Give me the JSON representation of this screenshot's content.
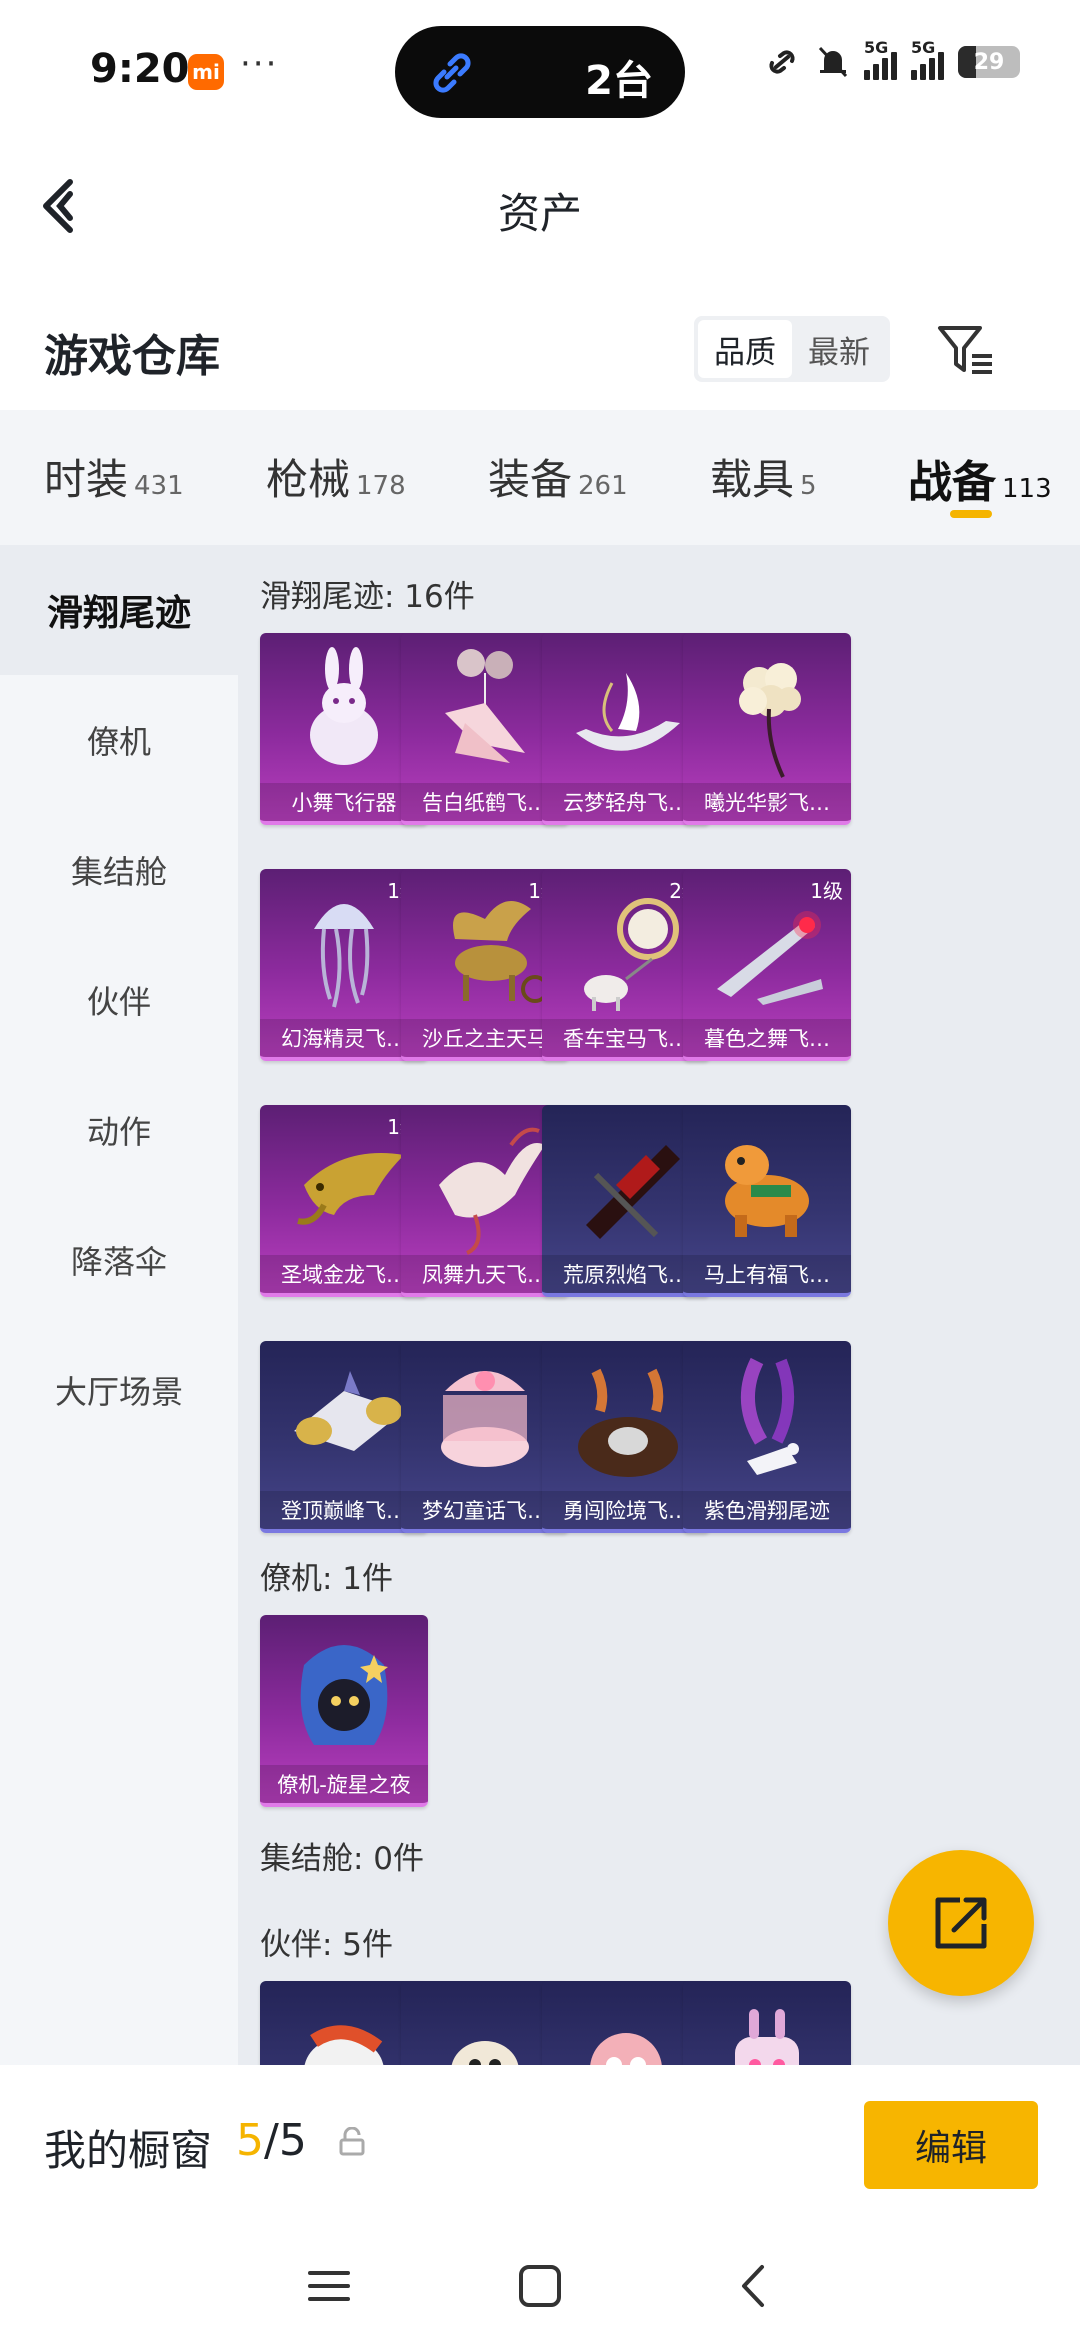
{
  "status_bar": {
    "time": "9:20",
    "mi_badge": "mi",
    "dots": "···",
    "island_text": "2台",
    "battery": "29",
    "battery_level": 0.29,
    "signal_labels": [
      "5G",
      "5G"
    ]
  },
  "header": {
    "title": "资产",
    "back_icon": "chevron-left-icon"
  },
  "warehouse": {
    "title": "游戏仓库",
    "sort_options": [
      "品质",
      "最新"
    ],
    "sort_selected": "品质",
    "filter_icon": "filter-icon"
  },
  "tabs": [
    {
      "label": "时装",
      "count": "431"
    },
    {
      "label": "枪械",
      "count": "178"
    },
    {
      "label": "装备",
      "count": "261"
    },
    {
      "label": "载具",
      "count": "5"
    },
    {
      "label": "战备",
      "count": "113",
      "active": true
    }
  ],
  "sidebar": [
    {
      "label": "滑翔尾迹",
      "active": true
    },
    {
      "label": "僚机"
    },
    {
      "label": "集结舱"
    },
    {
      "label": "伙伴"
    },
    {
      "label": "动作"
    },
    {
      "label": "降落伞"
    },
    {
      "label": "大厅场景"
    }
  ],
  "sections": {
    "glide": {
      "title": "滑翔尾迹: 16件",
      "items": [
        {
          "name": "小舞飞行器",
          "rarity": "purple",
          "icon": "white-rabbit-icon"
        },
        {
          "name": "告白纸鹤飞…",
          "rarity": "purple",
          "icon": "paper-crane-icon"
        },
        {
          "name": "云梦轻舟飞…",
          "rarity": "purple",
          "icon": "boat-icon"
        },
        {
          "name": "曦光华影飞…",
          "rarity": "purple",
          "icon": "flower-icon"
        },
        {
          "name": "幻海精灵飞…",
          "rarity": "purple",
          "level": "1级",
          "icon": "jellyfish-icon"
        },
        {
          "name": "沙丘之主天马",
          "rarity": "purple",
          "level": "1级",
          "icon": "pegasus-icon"
        },
        {
          "name": "香车宝马飞…",
          "rarity": "purple",
          "level": "2级",
          "icon": "carriage-icon"
        },
        {
          "name": "暮色之舞飞…",
          "rarity": "purple",
          "level": "1级",
          "icon": "blade-icon"
        },
        {
          "name": "圣域金龙飞…",
          "rarity": "purple",
          "level": "1级",
          "icon": "dragon-icon"
        },
        {
          "name": "凤舞九天飞…",
          "rarity": "purple",
          "icon": "phoenix-icon"
        },
        {
          "name": "荒原烈焰飞…",
          "rarity": "blue",
          "icon": "flame-craft-icon"
        },
        {
          "name": "马上有福飞…",
          "rarity": "blue",
          "icon": "toy-horse-icon"
        },
        {
          "name": "登顶巅峰飞…",
          "rarity": "blue",
          "icon": "jet-icon"
        },
        {
          "name": "梦幻童话飞…",
          "rarity": "blue",
          "icon": "carousel-icon"
        },
        {
          "name": "勇闯险境飞…",
          "rarity": "blue",
          "icon": "smoke-craft-icon"
        },
        {
          "name": "紫色滑翔尾迹",
          "rarity": "blue",
          "icon": "purple-trail-icon"
        }
      ]
    },
    "wingman": {
      "title": "僚机: 1件",
      "items": [
        {
          "name": "僚机-旋星之夜",
          "rarity": "purple",
          "icon": "star-cat-icon"
        }
      ]
    },
    "pod": {
      "title": "集结舱: 0件"
    },
    "partner": {
      "title": "伙伴: 5件",
      "items": [
        {
          "name": "",
          "rarity": "blue",
          "icon": "partner-fox-icon"
        },
        {
          "name": "",
          "rarity": "blue",
          "icon": "partner-bird-icon"
        },
        {
          "name": "",
          "rarity": "blue",
          "icon": "partner-pink-icon"
        },
        {
          "name": "",
          "rarity": "blue",
          "icon": "partner-robot-icon"
        }
      ]
    }
  },
  "fab": {
    "icon": "share-external-icon"
  },
  "window": {
    "title": "我的橱窗",
    "current": "5",
    "total": "/5",
    "edit_label": "编辑"
  },
  "colors": {
    "accent": "#f7b500",
    "purple_card": "#8d2b9e",
    "blue_card": "#34346f"
  }
}
